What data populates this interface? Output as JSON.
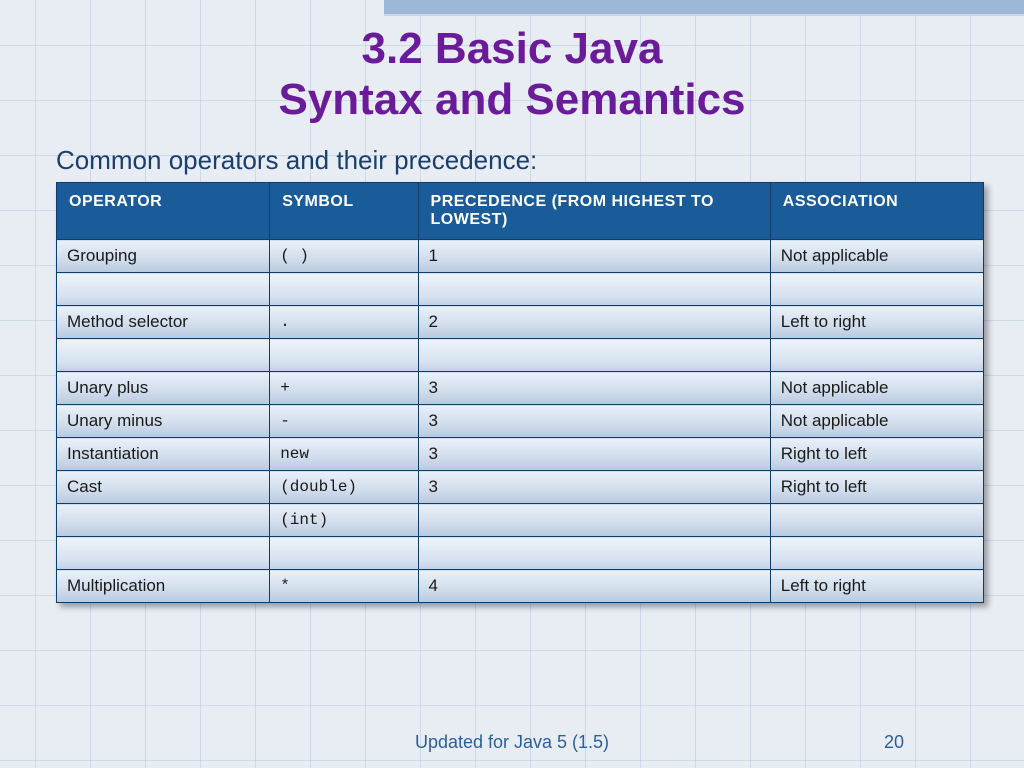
{
  "title_line1": "3.2  Basic Java",
  "title_line2": "Syntax and Semantics",
  "subtitle": "Common operators and their precedence:",
  "headers": {
    "operator": "OPERATOR",
    "symbol": "SYMBOL",
    "precedence": "PRECEDENCE (FROM HIGHEST TO LOWEST)",
    "association": "ASSOCIATION"
  },
  "rows": [
    {
      "operator": "Grouping",
      "symbol": "( )",
      "precedence": "1",
      "association": "Not applicable"
    },
    {
      "operator": "",
      "symbol": "",
      "precedence": "",
      "association": "",
      "blank": true
    },
    {
      "operator": "Method selector",
      "symbol": ".",
      "precedence": "2",
      "association": "Left to right"
    },
    {
      "operator": "",
      "symbol": "",
      "precedence": "",
      "association": "",
      "blank": true
    },
    {
      "operator": "Unary plus",
      "symbol": "+",
      "precedence": "3",
      "association": "Not applicable"
    },
    {
      "operator": "Unary minus",
      "symbol": "-",
      "precedence": "3",
      "association": "Not applicable"
    },
    {
      "operator": "Instantiation",
      "symbol": "new",
      "precedence": "3",
      "association": "Right to left"
    },
    {
      "operator": "Cast",
      "symbol": "(double)",
      "precedence": "3",
      "association": "Right to left"
    },
    {
      "operator": "",
      "symbol": "(int)",
      "precedence": "",
      "association": ""
    },
    {
      "operator": "",
      "symbol": "",
      "precedence": "",
      "association": "",
      "blank": true
    },
    {
      "operator": "Multiplication",
      "symbol": "*",
      "precedence": "4",
      "association": "Left to right"
    }
  ],
  "footer": {
    "update_note": "Updated for Java 5 (1.5)",
    "page_number": "20"
  }
}
